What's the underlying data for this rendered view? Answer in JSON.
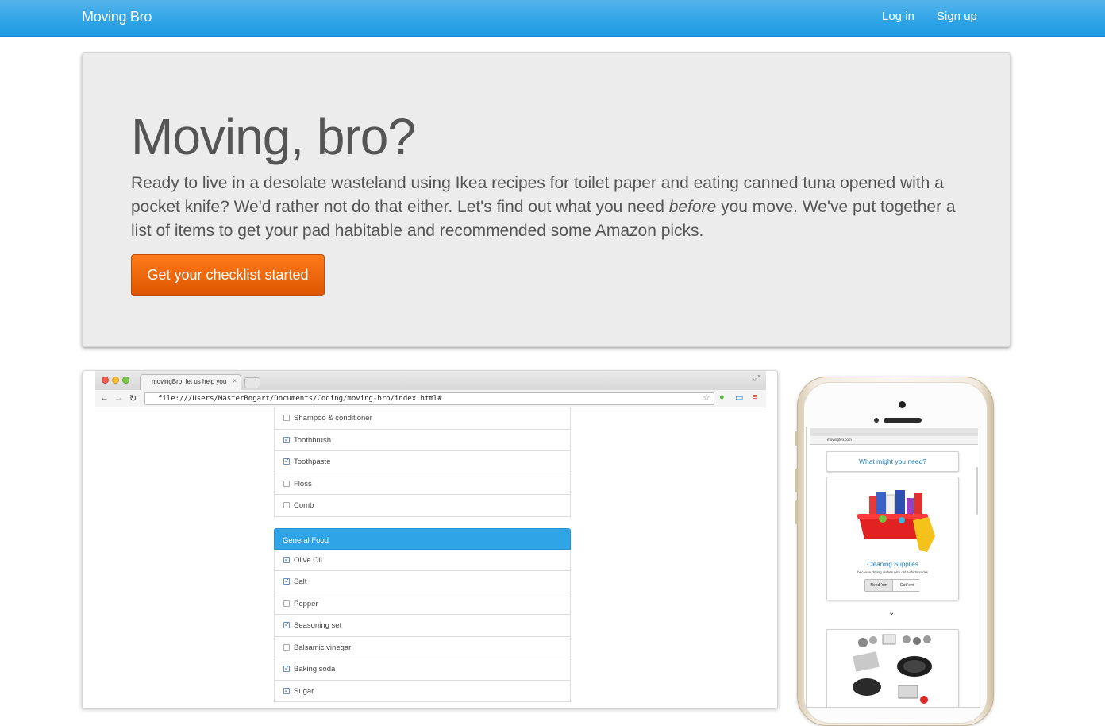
{
  "navbar": {
    "brand": "Moving Bro",
    "login": "Log in",
    "signup": "Sign up"
  },
  "hero": {
    "title": "Moving, bro?",
    "text_before": "Ready to live in a desolate wasteland using Ikea recipes for toilet paper and eating canned tuna opened with a pocket knife? We'd rather not do that either. Let's find out what you need ",
    "text_emph": "before",
    "text_after": " you move. We've put together a list of items to get your pad habitable and recommended some Amazon picks.",
    "cta": "Get your checklist started"
  },
  "desktop_shot": {
    "tab_title": "movingBro: let us help you",
    "tab_close": "×",
    "url": "file:///Users/MasterBogart/Documents/Coding/moving-bro/index.html#",
    "items_top": [
      {
        "label": "Shampoo & conditioner",
        "checked": false
      },
      {
        "label": "Toothbrush",
        "checked": true
      },
      {
        "label": "Toothpaste",
        "checked": true
      },
      {
        "label": "Floss",
        "checked": false
      },
      {
        "label": "Comb",
        "checked": false
      }
    ],
    "group_title": "General Food",
    "items_food": [
      {
        "label": "Olive Oil",
        "checked": true
      },
      {
        "label": "Salt",
        "checked": true
      },
      {
        "label": "Pepper",
        "checked": false
      },
      {
        "label": "Seasoning set",
        "checked": true
      },
      {
        "label": "Balsamic vinegar",
        "checked": false
      },
      {
        "label": "Baking soda",
        "checked": true
      },
      {
        "label": "Sugar",
        "checked": true
      }
    ]
  },
  "phone_shot": {
    "url": "movingbro.com",
    "heading": "What might you need?",
    "item_title": "Cleaning Supplies",
    "item_sub": "because drying dishes with old t-shirts sucks",
    "need_btn": "Need 'em",
    "got_btn": "Got 'em"
  },
  "colors": {
    "navbar": "#2fa4e7",
    "cta": "#e96a0e",
    "group_header": "#2fa4e7"
  }
}
